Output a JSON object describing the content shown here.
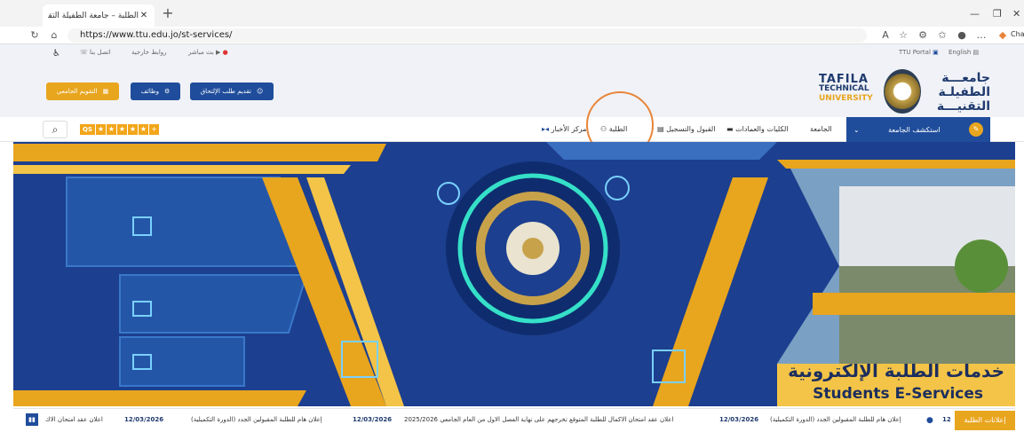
{
  "browser": {
    "tab_title": "الطلبة – جامعة الطفيلة التقنية – (TTU)",
    "url": "https://www.ttu.edu.jo/st-services/",
    "chat_label": "Cha"
  },
  "topstrip": {
    "live": "بث مباشر",
    "external_links": "روابط خارجية",
    "contact": "اتصل بنا",
    "ttu_portal": "TTU Portal",
    "english": "English"
  },
  "header": {
    "calendar_btn": "التقويم الجامعي",
    "jobs_btn": "وظائف",
    "apply_btn": "تقديم طلب الإلتحاق",
    "logo_en_line1": "TAFILA",
    "logo_en_line2": "TECHNICAL",
    "logo_en_line3": "UNIVERSITY",
    "logo_ar_line1": "جامعـــة",
    "logo_ar_line2": "الطفيلـة",
    "logo_ar_line3": "التقنيـــة"
  },
  "nav": {
    "explore": "استكشف الجامعة",
    "university": "الجامعة",
    "colleges": "الكليات والعمادات",
    "admission": "القبول والتسجيل",
    "students": "الطلبة",
    "news": "مركز الأخبار",
    "rating_badge": "QS"
  },
  "banner": {
    "title_ar": "خدمات الطلبة الإلكترونية",
    "title_en": "Students E-Services",
    "seal_text": "TAFILA TECHNICAL UNIVERSITY"
  },
  "ticker": {
    "label": "إعلانات الطلبة",
    "items": [
      {
        "date": "12/03/2026",
        "text": "إعلان هام للطلبة المقبولين الجدد (الدورة التكميلية)"
      },
      {
        "date": "12/03/2026",
        "text": "اعلان عقد امتحان الاكمال للطلبة المتوقع تخرجهم على نهاية الفصل الاول من العام الجامعي 2025/2026"
      },
      {
        "date": "12/03/2026",
        "text": "إعلان هام للطلبة المقبولين الجدد (الدورة التكميلية)"
      },
      {
        "date": "12/03/2026",
        "text": "اعلان عقد امتحان الاك"
      }
    ],
    "first_edge": "12"
  },
  "colors": {
    "brand_blue": "#1f4d9b",
    "brand_gold": "#e8a51e",
    "highlight": "#e8853a"
  }
}
